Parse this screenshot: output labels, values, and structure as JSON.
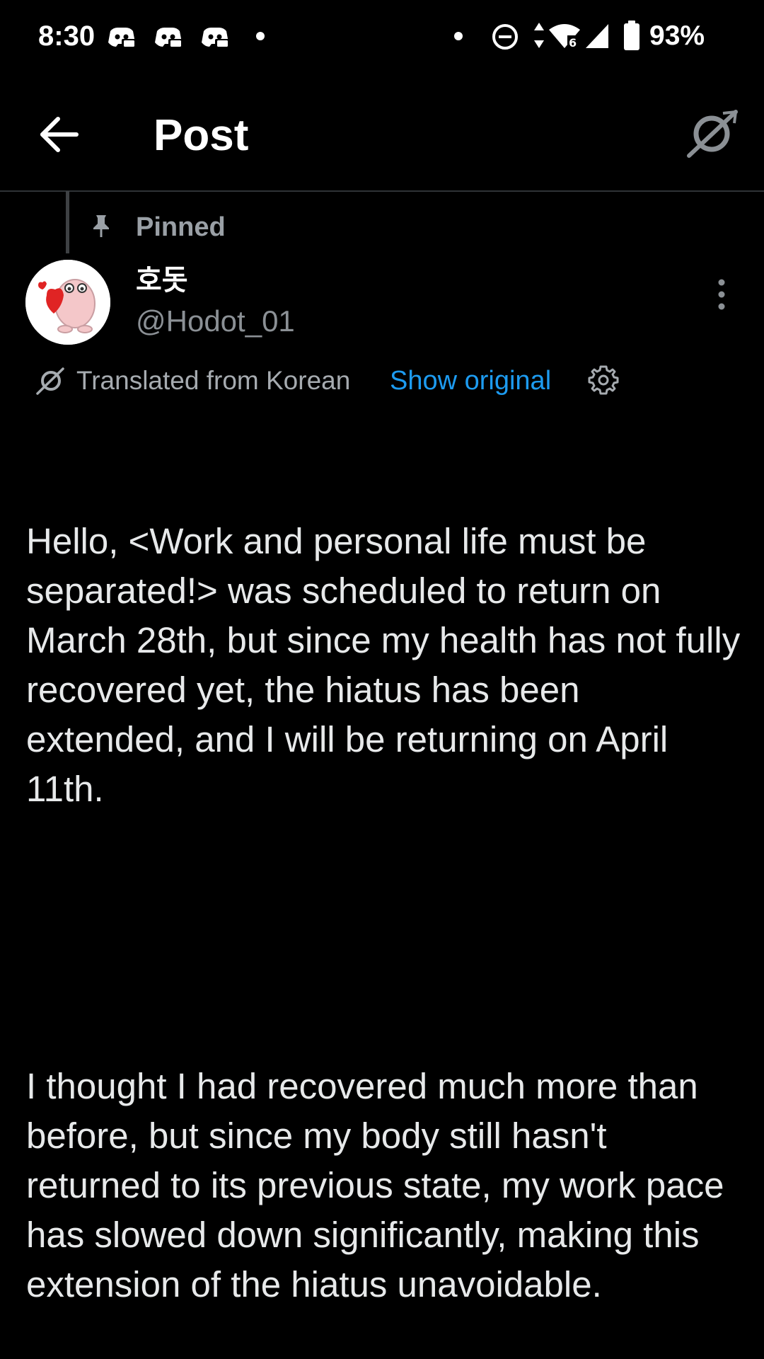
{
  "status_bar": {
    "time": "8:30",
    "battery": "93%",
    "icons": [
      "discord-icon",
      "discord-icon",
      "discord-icon",
      "dot-icon",
      "dot-icon",
      "do-not-disturb-icon",
      "data-arrows-icon",
      "wifi-icon",
      "signal-icon",
      "battery-icon"
    ]
  },
  "header": {
    "title": "Post",
    "back_icon": "back-arrow-icon",
    "action_icon": "grok-icon"
  },
  "post": {
    "pinned_label": "Pinned",
    "author": {
      "name": "호돗",
      "handle": "@Hodot_01"
    },
    "translation": {
      "label": "Translated from Korean",
      "show_original": "Show original"
    },
    "paragraphs": [
      "Hello, <Work and personal life must be separated!> was scheduled to return on March 28th, but since my health has not fully recovered yet, the hiatus has been extended, and I will be returning on April 11th.",
      "I thought I had recovered much more than before, but since my body still hasn't returned to its previous state, my work pace has slowed down significantly, making this extension of the hiatus unavoidable."
    ]
  },
  "colors": {
    "background": "#000000",
    "text": "#e7e9ea",
    "muted": "#8b9095",
    "link": "#1d9bf0",
    "divider": "#2f3336"
  }
}
